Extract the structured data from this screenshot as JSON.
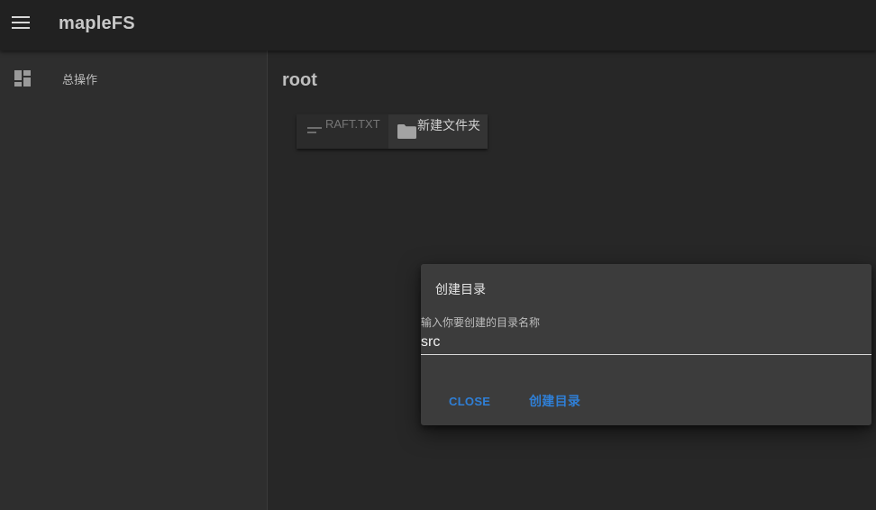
{
  "app": {
    "title": "mapleFS"
  },
  "sidebar": {
    "items": [
      {
        "label": "总操作",
        "icon": "dashboard-icon"
      }
    ]
  },
  "main": {
    "breadcrumb": "root",
    "entries": [
      {
        "name": "RAFT.TXT",
        "icon": "file-lines-icon",
        "type": "file"
      },
      {
        "name": "新建文件夹",
        "icon": "folder-icon",
        "type": "folder"
      }
    ]
  },
  "dialog": {
    "title": "创建目录",
    "field_label": "输入你要创建的目录名称",
    "field_value": "src",
    "close_label": "CLOSE",
    "create_label": "创建目录"
  },
  "colors": {
    "accent": "#2f7fd6",
    "appbar": "#212121",
    "background": "#272727",
    "dialog": "#3c3c3c"
  }
}
